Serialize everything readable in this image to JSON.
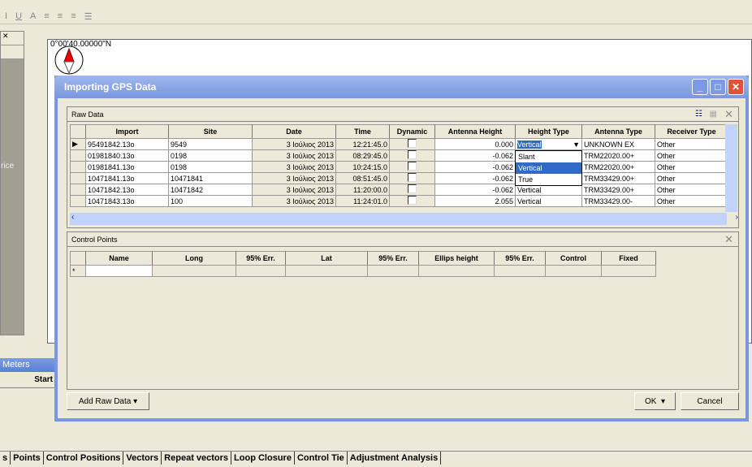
{
  "map": {
    "coord_label": "0°00'40.00000\"N"
  },
  "left": {
    "partial_text": "rice",
    "meters_label": "Meters",
    "start_label": "Start"
  },
  "dialog": {
    "title": "Importing GPS Data",
    "raw_data": {
      "title": "Raw Data",
      "columns": [
        "Import",
        "Site",
        "Date",
        "Time",
        "Dynamic",
        "Antenna Height",
        "Height Type",
        "Antenna Type",
        "Receiver Type"
      ],
      "rows": [
        [
          "95491842.13o",
          "9549",
          "3 Ιούλιος 2013",
          "12:21:45.0",
          false,
          "0.000",
          "Vertical",
          "UNKNOWN EX",
          "Other"
        ],
        [
          "01981840.13o",
          "0198",
          "3 Ιούλιος 2013",
          "08:29:45.0",
          false,
          "-0.062",
          "",
          "TRM22020.00+",
          "Other"
        ],
        [
          "01981841.13o",
          "0198",
          "3 Ιούλιος 2013",
          "10:24:15.0",
          false,
          "-0.062",
          "",
          "TRM22020.00+",
          "Other"
        ],
        [
          "10471841.13o",
          "10471841",
          "3 Ιούλιος 2013",
          "08:51:45.0",
          false,
          "-0.062",
          "",
          "TRM33429.00+",
          "Other"
        ],
        [
          "10471842.13o",
          "10471842",
          "3 Ιούλιος 2013",
          "11:20:00.0",
          false,
          "-0.062",
          "Vertical",
          "TRM33429.00+",
          "Other"
        ],
        [
          "10471843.13o",
          "100",
          "3 Ιούλιος 2013",
          "11:24:01.0",
          false,
          "2.055",
          "Vertical",
          "TRM33429.00-",
          "Other"
        ]
      ],
      "height_type_options": [
        "Slant",
        "Vertical",
        "True"
      ],
      "height_type_selected": "Vertical"
    },
    "control_points": {
      "title": "Control Points",
      "columns": [
        "Name",
        "Long",
        "95% Err.",
        "Lat",
        "95% Err.",
        "Ellips height",
        "95% Err.",
        "Control",
        "Fixed"
      ],
      "new_row_marker": "*"
    },
    "buttons": {
      "add_raw_data": "Add Raw Data",
      "ok": "OK",
      "cancel": "Cancel"
    }
  },
  "bottom_tabs": [
    "s",
    "Points",
    "Control Positions",
    "Vectors",
    "Repeat vectors",
    "Loop Closure",
    "Control Tie",
    "Adjustment Analysis"
  ]
}
